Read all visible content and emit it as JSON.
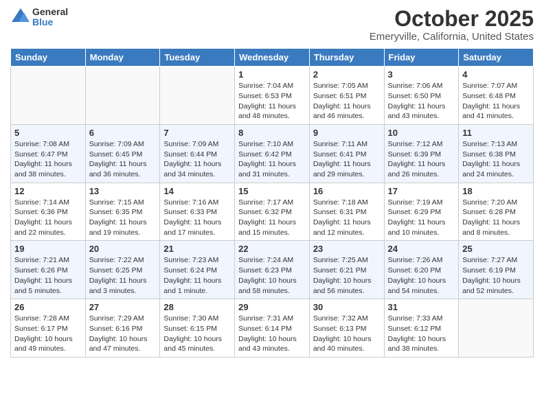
{
  "logo": {
    "general": "General",
    "blue": "Blue"
  },
  "title": "October 2025",
  "subtitle": "Emeryville, California, United States",
  "days_of_week": [
    "Sunday",
    "Monday",
    "Tuesday",
    "Wednesday",
    "Thursday",
    "Friday",
    "Saturday"
  ],
  "weeks": [
    [
      {
        "day": "",
        "info": ""
      },
      {
        "day": "",
        "info": ""
      },
      {
        "day": "",
        "info": ""
      },
      {
        "day": "1",
        "info": "Sunrise: 7:04 AM\nSunset: 6:53 PM\nDaylight: 11 hours\nand 48 minutes."
      },
      {
        "day": "2",
        "info": "Sunrise: 7:05 AM\nSunset: 6:51 PM\nDaylight: 11 hours\nand 46 minutes."
      },
      {
        "day": "3",
        "info": "Sunrise: 7:06 AM\nSunset: 6:50 PM\nDaylight: 11 hours\nand 43 minutes."
      },
      {
        "day": "4",
        "info": "Sunrise: 7:07 AM\nSunset: 6:48 PM\nDaylight: 11 hours\nand 41 minutes."
      }
    ],
    [
      {
        "day": "5",
        "info": "Sunrise: 7:08 AM\nSunset: 6:47 PM\nDaylight: 11 hours\nand 38 minutes."
      },
      {
        "day": "6",
        "info": "Sunrise: 7:09 AM\nSunset: 6:45 PM\nDaylight: 11 hours\nand 36 minutes."
      },
      {
        "day": "7",
        "info": "Sunrise: 7:09 AM\nSunset: 6:44 PM\nDaylight: 11 hours\nand 34 minutes."
      },
      {
        "day": "8",
        "info": "Sunrise: 7:10 AM\nSunset: 6:42 PM\nDaylight: 11 hours\nand 31 minutes."
      },
      {
        "day": "9",
        "info": "Sunrise: 7:11 AM\nSunset: 6:41 PM\nDaylight: 11 hours\nand 29 minutes."
      },
      {
        "day": "10",
        "info": "Sunrise: 7:12 AM\nSunset: 6:39 PM\nDaylight: 11 hours\nand 26 minutes."
      },
      {
        "day": "11",
        "info": "Sunrise: 7:13 AM\nSunset: 6:38 PM\nDaylight: 11 hours\nand 24 minutes."
      }
    ],
    [
      {
        "day": "12",
        "info": "Sunrise: 7:14 AM\nSunset: 6:36 PM\nDaylight: 11 hours\nand 22 minutes."
      },
      {
        "day": "13",
        "info": "Sunrise: 7:15 AM\nSunset: 6:35 PM\nDaylight: 11 hours\nand 19 minutes."
      },
      {
        "day": "14",
        "info": "Sunrise: 7:16 AM\nSunset: 6:33 PM\nDaylight: 11 hours\nand 17 minutes."
      },
      {
        "day": "15",
        "info": "Sunrise: 7:17 AM\nSunset: 6:32 PM\nDaylight: 11 hours\nand 15 minutes."
      },
      {
        "day": "16",
        "info": "Sunrise: 7:18 AM\nSunset: 6:31 PM\nDaylight: 11 hours\nand 12 minutes."
      },
      {
        "day": "17",
        "info": "Sunrise: 7:19 AM\nSunset: 6:29 PM\nDaylight: 11 hours\nand 10 minutes."
      },
      {
        "day": "18",
        "info": "Sunrise: 7:20 AM\nSunset: 6:28 PM\nDaylight: 11 hours\nand 8 minutes."
      }
    ],
    [
      {
        "day": "19",
        "info": "Sunrise: 7:21 AM\nSunset: 6:26 PM\nDaylight: 11 hours\nand 5 minutes."
      },
      {
        "day": "20",
        "info": "Sunrise: 7:22 AM\nSunset: 6:25 PM\nDaylight: 11 hours\nand 3 minutes."
      },
      {
        "day": "21",
        "info": "Sunrise: 7:23 AM\nSunset: 6:24 PM\nDaylight: 11 hours\nand 1 minute."
      },
      {
        "day": "22",
        "info": "Sunrise: 7:24 AM\nSunset: 6:23 PM\nDaylight: 10 hours\nand 58 minutes."
      },
      {
        "day": "23",
        "info": "Sunrise: 7:25 AM\nSunset: 6:21 PM\nDaylight: 10 hours\nand 56 minutes."
      },
      {
        "day": "24",
        "info": "Sunrise: 7:26 AM\nSunset: 6:20 PM\nDaylight: 10 hours\nand 54 minutes."
      },
      {
        "day": "25",
        "info": "Sunrise: 7:27 AM\nSunset: 6:19 PM\nDaylight: 10 hours\nand 52 minutes."
      }
    ],
    [
      {
        "day": "26",
        "info": "Sunrise: 7:28 AM\nSunset: 6:17 PM\nDaylight: 10 hours\nand 49 minutes."
      },
      {
        "day": "27",
        "info": "Sunrise: 7:29 AM\nSunset: 6:16 PM\nDaylight: 10 hours\nand 47 minutes."
      },
      {
        "day": "28",
        "info": "Sunrise: 7:30 AM\nSunset: 6:15 PM\nDaylight: 10 hours\nand 45 minutes."
      },
      {
        "day": "29",
        "info": "Sunrise: 7:31 AM\nSunset: 6:14 PM\nDaylight: 10 hours\nand 43 minutes."
      },
      {
        "day": "30",
        "info": "Sunrise: 7:32 AM\nSunset: 6:13 PM\nDaylight: 10 hours\nand 40 minutes."
      },
      {
        "day": "31",
        "info": "Sunrise: 7:33 AM\nSunset: 6:12 PM\nDaylight: 10 hours\nand 38 minutes."
      },
      {
        "day": "",
        "info": ""
      }
    ]
  ]
}
